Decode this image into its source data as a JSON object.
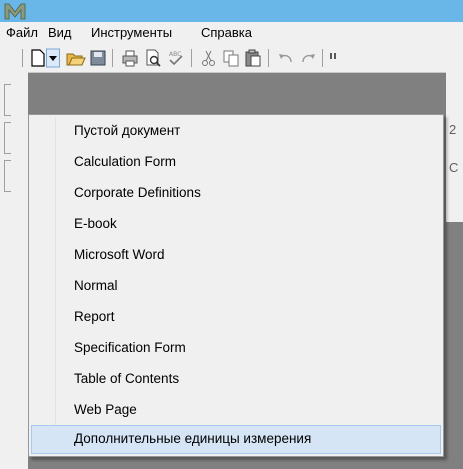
{
  "app": {
    "logo_letter": "M"
  },
  "menubar": {
    "items": [
      "Файл",
      "Вид",
      "Инструменты",
      "Справка"
    ]
  },
  "toolbar": {
    "icons": [
      "new-document-icon",
      "dropdown-arrow-icon",
      "open-folder-icon",
      "save-icon",
      "print-icon",
      "print-preview-icon",
      "spellcheck-icon",
      "cut-icon",
      "copy-icon",
      "paste-icon",
      "undo-icon",
      "redo-icon"
    ]
  },
  "background_fragments": {
    "r1": "2",
    "r2": "C"
  },
  "new_document_menu": {
    "items": [
      "Пустой документ",
      "Calculation Form",
      "Corporate Definitions",
      "E-book",
      "Microsoft Word",
      "Normal",
      "Report",
      "Specification Form",
      "Table of Contents",
      "Web Page",
      "Дополнительные единицы измерения"
    ],
    "highlighted_index": 10
  },
  "colors": {
    "titlebar": "#69b6e8",
    "menu_highlight": "#d5e5f6",
    "menu_highlight_border": "#a6c9ef",
    "logo": "#8a9a7a"
  }
}
